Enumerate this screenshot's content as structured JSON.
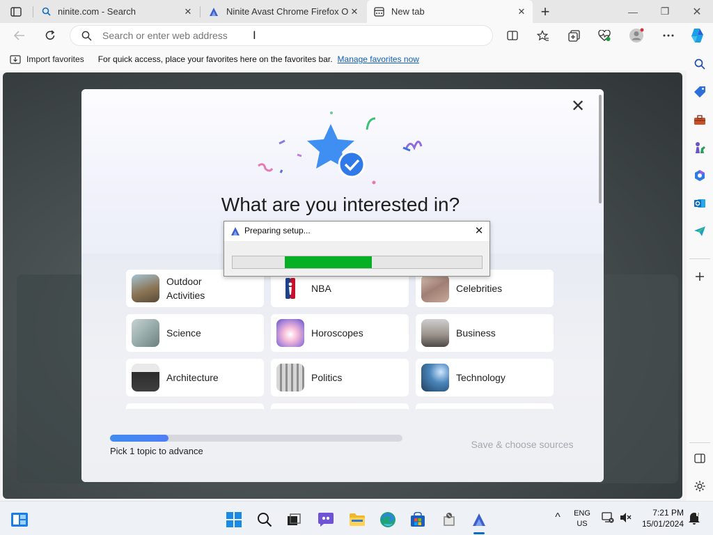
{
  "tabs": [
    {
      "title": "ninite.com - Search",
      "icon": "search-icon"
    },
    {
      "title": "Ninite Avast Chrome Firefox Ope",
      "icon": "ninite-icon"
    },
    {
      "title": "New tab",
      "icon": "new-tab-icon",
      "active": true
    }
  ],
  "tab_close_glyph": "✕",
  "new_tab_glyph": "+",
  "window_controls": {
    "minimize": "—",
    "restore": "❐",
    "close": "✕"
  },
  "address_bar": {
    "placeholder": "Search or enter web address",
    "value": ""
  },
  "favorites_bar": {
    "import_label": "Import favorites",
    "message": "For quick access, place your favorites here on the favorites bar.",
    "manage_link": "Manage favorites now"
  },
  "interests": {
    "title": "What are you interested in?",
    "close_glyph": "✕",
    "topics": [
      {
        "label": "Outdoor Activities",
        "color": "#8a7a5c"
      },
      {
        "label": "NBA",
        "color": "#1d428a"
      },
      {
        "label": "Celebrities",
        "color": "#b49484"
      },
      {
        "label": "Science",
        "color": "#9fb0ae"
      },
      {
        "label": "Horoscopes",
        "color": "#d58fc0"
      },
      {
        "label": "Business",
        "color": "#9a8f88"
      },
      {
        "label": "Architecture",
        "color": "#3b3b3b"
      },
      {
        "label": "Politics",
        "color": "#8f8f8f"
      },
      {
        "label": "Technology",
        "color": "#2c5f86"
      }
    ],
    "progress_fraction": 0.2,
    "progress_label": "Pick 1 topic to advance",
    "save_button": "Save & choose sources"
  },
  "dialog": {
    "title": "Preparing setup...",
    "close_glyph": "✕",
    "progress_start_fraction": 0.21,
    "progress_end_fraction": 0.56,
    "fill_color": "#06b025"
  },
  "tray": {
    "language": "ENG",
    "region": "US",
    "time": "7:21 PM",
    "date": "15/01/2024",
    "chevron_glyph": "^"
  },
  "colors": {
    "accent": "#0f6cbd",
    "link": "#0f5fb9"
  }
}
